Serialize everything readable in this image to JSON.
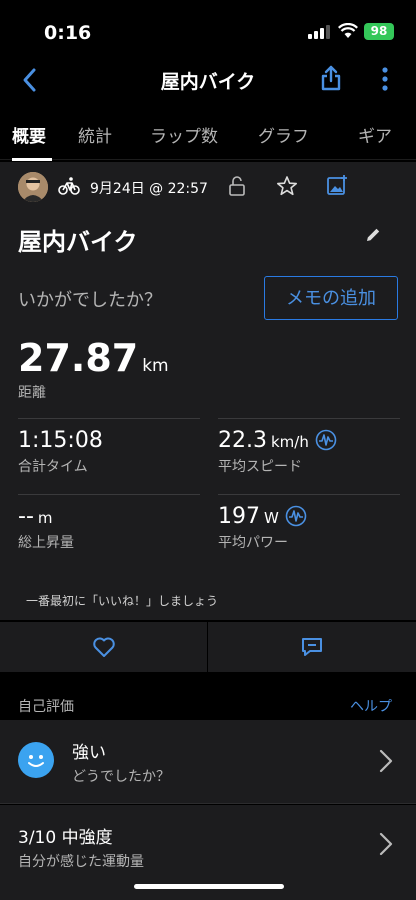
{
  "status": {
    "time": "0:16",
    "battery": "98"
  },
  "nav": {
    "title": "屋内バイク"
  },
  "tabs": [
    {
      "label": "概要",
      "active": true
    },
    {
      "label": "統計",
      "active": false
    },
    {
      "label": "ラップ数",
      "active": false
    },
    {
      "label": "グラフ",
      "active": false
    },
    {
      "label": "ギア",
      "active": false
    }
  ],
  "activity": {
    "datetime": "9月24日 @ 22:57",
    "title": "屋内バイク",
    "prompt": "いかがでしたか？",
    "memo_button": "メモの追加"
  },
  "distance": {
    "value": "27.87",
    "unit": "km",
    "label": "距離"
  },
  "stats": {
    "total_time": {
      "value": "1:15:08",
      "unit": "",
      "label": "合計タイム"
    },
    "avg_speed": {
      "value": "22.3",
      "unit": "km/h",
      "label": "平均スピード"
    },
    "ascent": {
      "value": "--",
      "unit": "m",
      "label": "総上昇量"
    },
    "avg_power": {
      "value": "197",
      "unit": "W",
      "label": "平均パワー"
    }
  },
  "like_prompt": "一番最初に「いいね！」しましょう",
  "self_eval": {
    "header": "自己評価",
    "help": "ヘルプ",
    "feel_title": "強い",
    "feel_sub": "どうでしたか？",
    "effort_title": "3/10 中強度",
    "effort_sub": "自分が感じた運動量"
  },
  "colors": {
    "accent": "#4a90e2",
    "card": "#1c1c1e",
    "battery": "#34c759",
    "smile": "#3ba3f0"
  }
}
